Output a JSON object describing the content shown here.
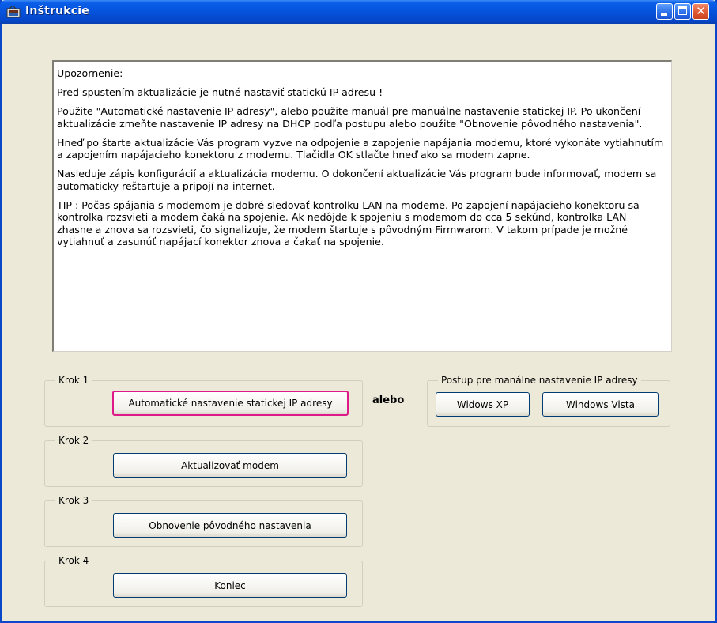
{
  "window": {
    "title": "Inštrukcie",
    "controls": {
      "minimize": "minimize",
      "maximize": "maximize",
      "close": "✕"
    }
  },
  "instructions": {
    "paragraphs": [
      "Upozornenie:",
      "Pred spustením aktualizácie je nutné nastaviť statickú IP adresu !",
      "Použite \"Automatické nastavenie IP adresy\", alebo použite manuál pre manuálne nastavenie statickej IP. Po ukončení aktualizácie zmeňte nastavenie IP adresy na DHCP podľa postupu alebo použite \"Obnovenie pôvodného nastavenia\".",
      "Hneď po štarte aktualizácie Vás program vyzve na odpojenie a zapojenie napájania modemu, ktoré vykonáte vytiahnutím a zapojením napájacieho konektoru z modemu. Tlačidla OK stlačte hneď ako sa modem zapne.",
      "Nasleduje zápis konfigurácií a aktualizácia modemu. O dokončení aktualizácie Vás program bude informovať, modem sa automaticky reštartuje a pripojí na internet.",
      "TIP : Počas spájania s modemom je dobré sledovať kontrolku LAN na modeme. Po zapojení napájacieho konektoru sa kontrolka rozsvieti a modem čaká na spojenie. Ak nedôjde k spojeniu s modemom do cca 5 sekúnd, kontrolka LAN zhasne a znova sa rozsvieti, čo signalizuje, že modem štartuje s pôvodným Firmwarom. V takom prípade je možné vytiahnuť a zasunúť napájací konektor znova a čakať na spojenie."
    ]
  },
  "steps": [
    {
      "label": "Krok 1",
      "button": "Automatické nastavenie statickej IP adresy"
    },
    {
      "label": "Krok 2",
      "button": "Aktualizovať modem"
    },
    {
      "label": "Krok 3",
      "button": "Obnovenie pôvodného nastavenia"
    },
    {
      "label": "Krok 4",
      "button": "Koniec"
    }
  ],
  "alebo": "alebo",
  "manual": {
    "label": "Postup pre manálne nastavenie IP adresy",
    "buttons": [
      "Widows XP",
      "Windows Vista"
    ]
  },
  "colors": {
    "title_bar": "#0553dc",
    "window_bg": "#ece9d8",
    "focus_border": "#e0198a"
  }
}
